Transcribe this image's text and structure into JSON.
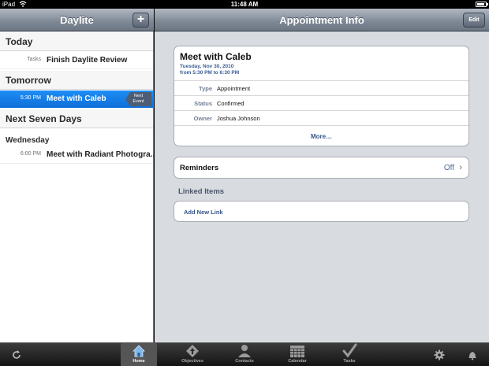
{
  "status_bar": {
    "carrier": "iPad",
    "time": "11:48 AM"
  },
  "left_pane": {
    "title": "Daylite",
    "add_button_label": "+",
    "sections": {
      "today": "Today",
      "tomorrow": "Tomorrow",
      "next_seven": "Next Seven Days"
    },
    "today_row": {
      "label": "Tasks",
      "value": "Finish Daylite Review"
    },
    "tomorrow_row": {
      "label": "5:30 PM",
      "value": "Meet with Caleb",
      "tag_line1": "Next",
      "tag_line2": "Event",
      "selected": true
    },
    "weekday": "Wednesday",
    "weekday_row": {
      "label": "6:00 PM",
      "value": "Meet with Radiant Photogra..."
    }
  },
  "right_pane": {
    "title": "Appointment Info",
    "edit_label": "Edit",
    "appointment": {
      "title": "Meet with Caleb",
      "date": "Tuesday, Nov 30, 2010",
      "time": "from 5:30 PM to 6:30 PM",
      "fields": [
        {
          "key": "Type",
          "value": "Appointment"
        },
        {
          "key": "Status",
          "value": "Confirmed"
        },
        {
          "key": "Owner",
          "value": "Joshua Johnson"
        }
      ],
      "more_label": "More…"
    },
    "reminders": {
      "label": "Reminders",
      "value": "Off"
    },
    "linked_items": {
      "header": "Linked Items",
      "add_label": "Add New Link"
    }
  },
  "tab_bar": {
    "tabs": [
      {
        "label": "Home",
        "icon": "home-icon",
        "active": true
      },
      {
        "label": "Objectives",
        "icon": "objectives-icon",
        "active": false
      },
      {
        "label": "Contacts",
        "icon": "contacts-icon",
        "active": false
      },
      {
        "label": "Calendar",
        "icon": "calendar-icon",
        "active": false
      },
      {
        "label": "Tasks",
        "icon": "checkmark-icon",
        "active": false
      }
    ],
    "left_icon": "refresh-icon",
    "right_icons": [
      "gear-icon",
      "bell-icon"
    ]
  },
  "colors": {
    "selection_blue": "#1480ea",
    "link_blue": "#34548a",
    "nav_gray": "#7e8895"
  }
}
